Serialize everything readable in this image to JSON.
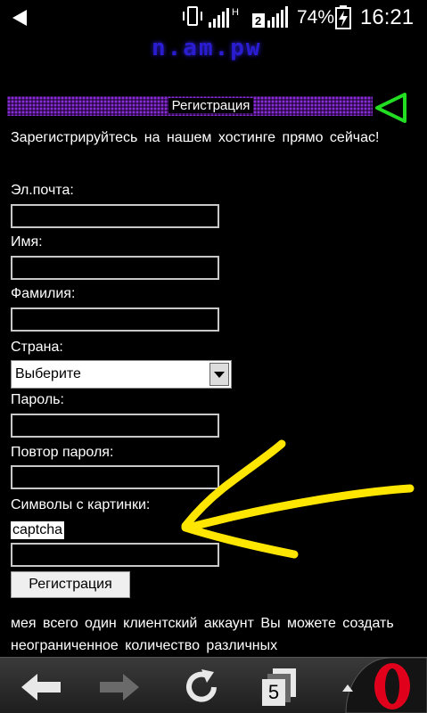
{
  "status_bar": {
    "battery_percent": "74%",
    "time": "16:21",
    "network_label": "H",
    "sim_label": "2"
  },
  "page": {
    "logo_text": "n.am.pw",
    "header_title": "Регистрация",
    "intro": "Зарегистрируйтесь на нашем хостинге прямо сейчас!",
    "form": {
      "email_label": "Эл.почта:",
      "first_name_label": "Имя:",
      "last_name_label": "Фамилия:",
      "country_label": "Страна:",
      "country_value": "Выберите",
      "password_label": "Пароль:",
      "password_repeat_label": "Повтор пароля:",
      "captcha_label": "Символы с картинки:",
      "captcha_image_text": "captcha",
      "submit_label": "Регистрация"
    },
    "bottom_text": "мея всего один клиентский аккаунт Вы можете создать неограниченное количество различных"
  },
  "nav_bar": {
    "tabs_count": "5"
  },
  "colors": {
    "background": "#000000",
    "header_purple": "#8a2cd6",
    "back_arrow_green": "#22dd22",
    "annotation_yellow": "#ffe600",
    "opera_red": "#e0001b"
  }
}
